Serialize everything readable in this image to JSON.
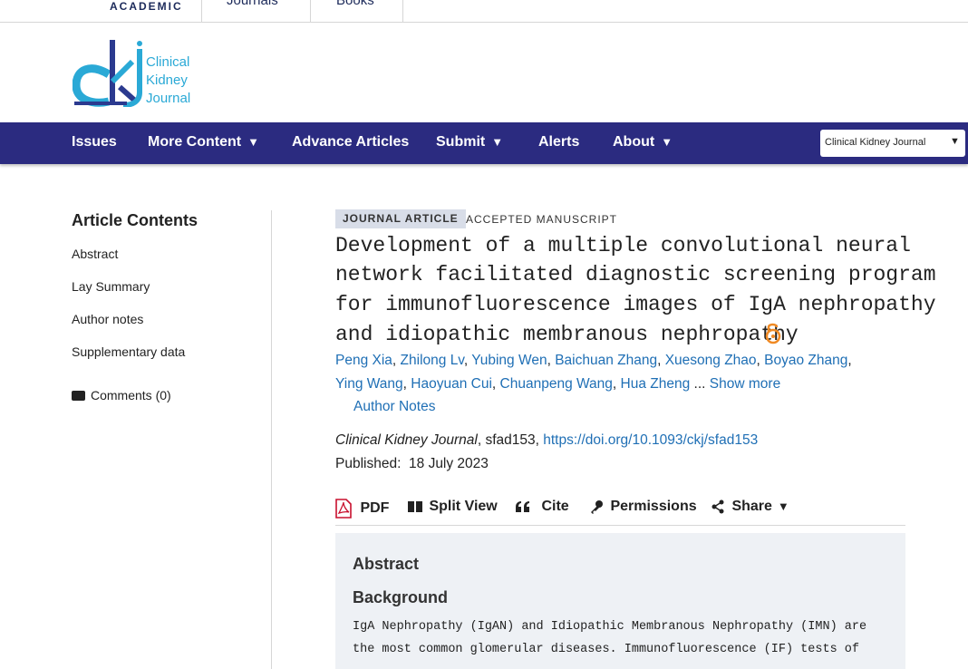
{
  "topbar": {
    "brand": "ACADEMIC",
    "nav": [
      "Journals",
      "Books"
    ]
  },
  "logo": {
    "line1": "Clinical",
    "line2": "Kidney",
    "line3": "Journal"
  },
  "nav": {
    "items": [
      "Issues",
      "More Content",
      "Advance Articles",
      "Submit",
      "Alerts",
      "About"
    ],
    "journal_select": "Clinical Kidney Journal"
  },
  "sidebar": {
    "title": "Article Contents",
    "links": [
      "Abstract",
      "Lay Summary",
      "Author notes",
      "Supplementary data"
    ],
    "comments": "Comments (0)"
  },
  "article": {
    "type_badge": "JOURNAL ARTICLE",
    "status": "ACCEPTED MANUSCRIPT",
    "title_lines": [
      "Development of a multiple convolutional neural",
      "network facilitated diagnostic screening program",
      "for immunofluorescence images of IgA nephropathy",
      "and idiopathic membranous nephropathy"
    ],
    "authors_line1": [
      "Peng Xia",
      "Zhilong Lv",
      "Yubing Wen",
      "Baichuan Zhang",
      "Xuesong Zhao",
      "Boyao Zhang"
    ],
    "authors_line2": [
      "Ying Wang",
      "Haoyuan Cui",
      "Chuanpeng Wang",
      "Hua Zheng"
    ],
    "show_more": "Show more",
    "author_notes": "Author Notes",
    "journal": "Clinical Kidney Journal",
    "article_id": "sfad153",
    "doi": "https://doi.org/10.1093/ckj/sfad153",
    "published_label": "Published:",
    "published_date": "18 July 2023"
  },
  "toolbar": {
    "pdf": "PDF",
    "split": "Split View",
    "cite": "Cite",
    "permissions": "Permissions",
    "share": "Share"
  },
  "abstract": {
    "heading": "Abstract",
    "subheading": "Background",
    "lines": [
      "IgA Nephropathy (IgAN) and Idiopathic Membranous Nephropathy (IMN) are",
      "the most common glomerular diseases. Immunofluorescence (IF) tests of"
    ]
  },
  "colors": {
    "nav_bg": "#2b2b80",
    "link": "#1f6fb5",
    "open_access": "#f08a24",
    "logo_blue": "#2aa9d6",
    "logo_navy": "#2b3a8f"
  },
  "icons": [
    "open-access-icon",
    "pdf-icon",
    "split-view-icon",
    "quote-icon",
    "key-icon",
    "share-icon",
    "comment-icon",
    "caret-down-icon"
  ]
}
